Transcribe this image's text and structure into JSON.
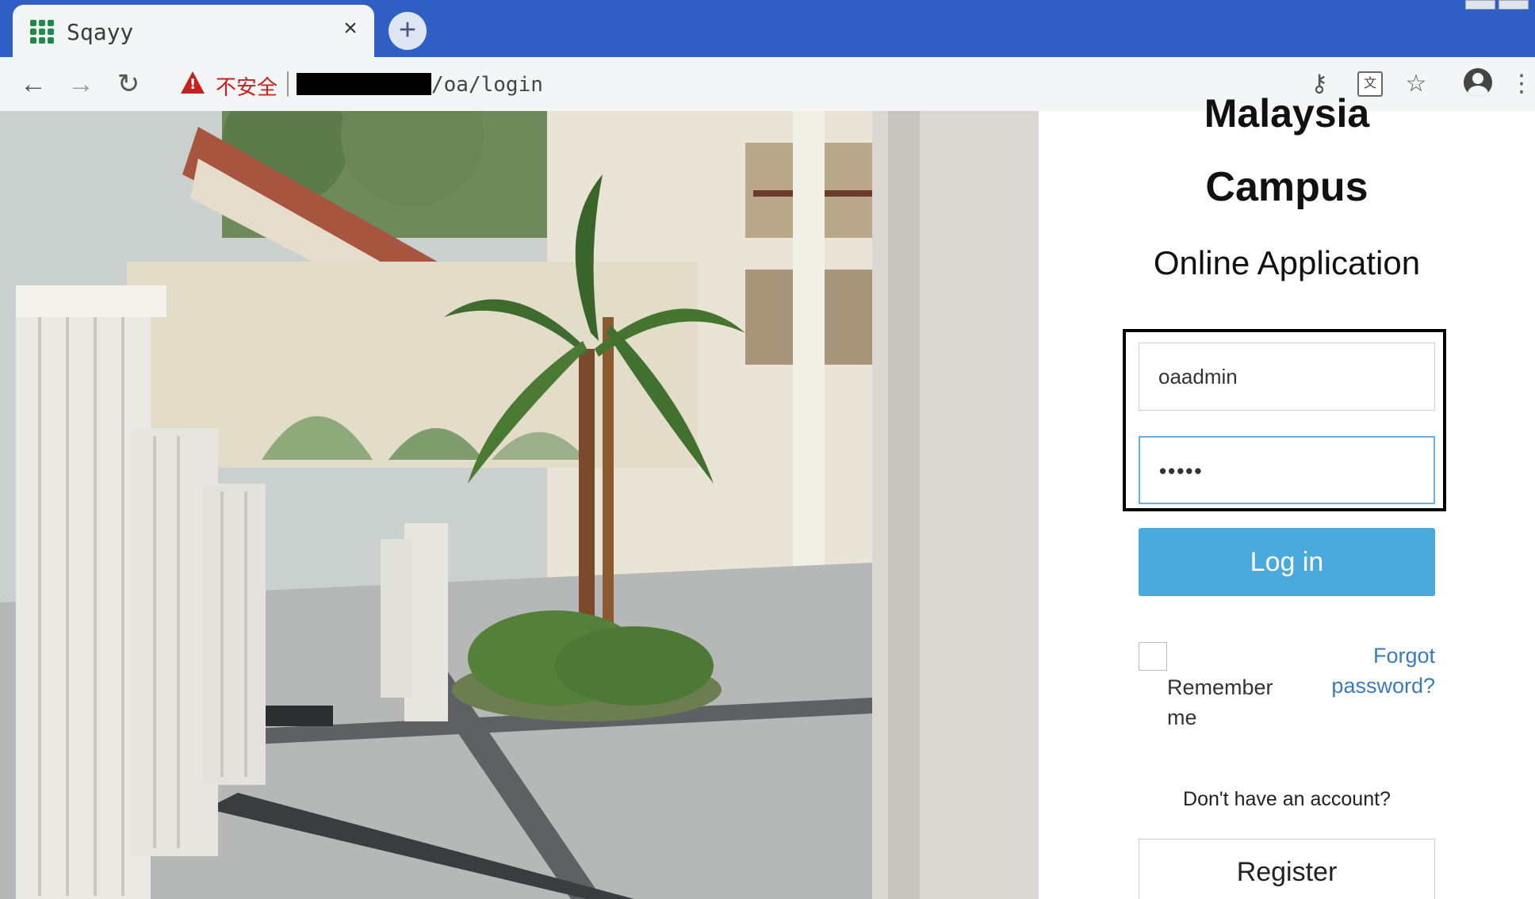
{
  "browser": {
    "tab_title": "Sqayy",
    "tab_close": "×",
    "new_tab": "+",
    "security_label": "不安全",
    "url_path": "/oa/login",
    "icons": {
      "back": "arrow-left-icon",
      "forward": "arrow-right-icon",
      "reload": "reload-icon",
      "security": "warning-triangle-icon",
      "key": "key-icon",
      "translate": "translate-icon",
      "bookmark": "star-icon",
      "profile": "profile-icon",
      "menu": "kebab-menu-icon"
    }
  },
  "login": {
    "heading_partial": "Malaysia",
    "heading": "Campus",
    "subheading": "Online Application",
    "username_value": "oaadmin",
    "password_value": "•••••",
    "login_label": "Log in",
    "remember_label": "Remember me",
    "forgot_label": "Forgot password?",
    "no_account_text": "Don't have an account?",
    "register_label": "Register"
  },
  "colors": {
    "tabstrip": "#2f5fc4",
    "login_button": "#4aaadd",
    "link": "#3a7bbf",
    "insecure": "#c5221f",
    "focus_border": "#66afe9"
  }
}
